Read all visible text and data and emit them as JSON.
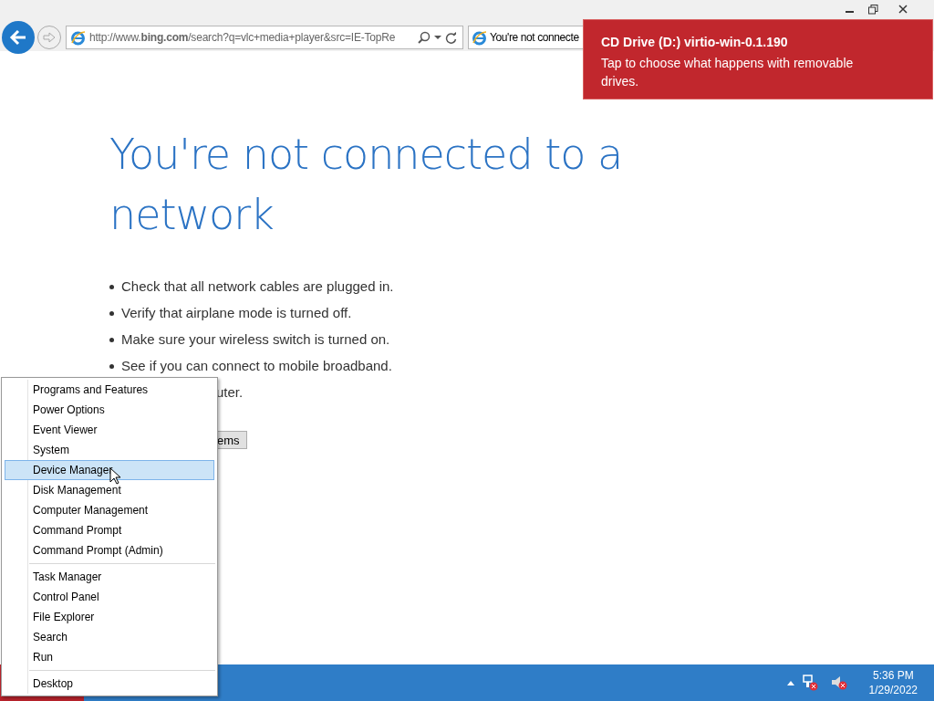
{
  "browser": {
    "address": "http://www.**bing.com**/search?q=vlc+media+player&src=IE-TopRe",
    "tab_title": "You're not connecte"
  },
  "notification": {
    "title": "CD Drive (D:) virtio-win-0.1.190",
    "message": "Tap to choose what happens with removable drives."
  },
  "page": {
    "heading": "You're not connected to a network",
    "bullets": [
      "Check that all network cables are plugged in.",
      "Verify that airplane mode is turned off.",
      "Make sure your wireless switch is turned on.",
      "See if you can connect to mobile broadband."
    ],
    "partial_bullet": "uter.",
    "partial_button": "ems"
  },
  "context_menu": {
    "groups": [
      [
        {
          "label": "Programs and Features",
          "selected": false
        },
        {
          "label": "Power Options",
          "selected": false
        },
        {
          "label": "Event Viewer",
          "selected": false
        },
        {
          "label": "System",
          "selected": false
        },
        {
          "label": "Device Manager",
          "selected": true
        },
        {
          "label": "Disk Management",
          "selected": false
        },
        {
          "label": "Computer Management",
          "selected": false
        },
        {
          "label": "Command Prompt",
          "selected": false
        },
        {
          "label": "Command Prompt (Admin)",
          "selected": false
        }
      ],
      [
        {
          "label": "Task Manager",
          "selected": false
        },
        {
          "label": "Control Panel",
          "selected": false
        },
        {
          "label": "File Explorer",
          "selected": false
        },
        {
          "label": "Search",
          "selected": false
        },
        {
          "label": "Run",
          "selected": false
        }
      ],
      [
        {
          "label": "Desktop",
          "selected": false
        }
      ]
    ]
  },
  "taskbar": {
    "time": "5:36 PM",
    "date": "1/29/2022"
  }
}
